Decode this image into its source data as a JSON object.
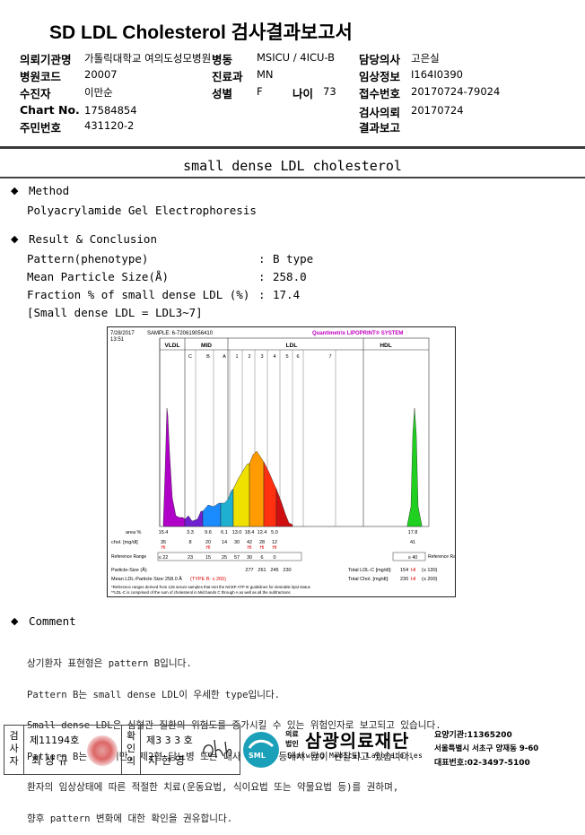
{
  "report_title": "SD LDL Cholesterol 검사결과보고서",
  "header": {
    "institution_label": "의뢰기관명",
    "institution_value": "가톨릭대학교 여의도성모병원",
    "ward_label": "병동",
    "ward_value": "MSICU / 4ICU-B",
    "doctor_label": "담당의사",
    "doctor_value": "고은실",
    "hospital_code_label": "병원코드",
    "hospital_code_value": "20007",
    "dept_label": "진료과",
    "dept_value": "MN",
    "clinical_info_label": "임상정보",
    "clinical_info_value": "I164I0390",
    "patient_label": "수진자",
    "patient_value": "이만순",
    "sex_label": "성별",
    "sex_value": "F",
    "age_label": "나이",
    "age_value": "73",
    "receipt_no_label": "접수번호",
    "receipt_no_value": "20170724-79024",
    "chart_no_label": "Chart No.",
    "chart_no_value": "17584854",
    "request_label": "검사의뢰",
    "request_value": "20170724",
    "resident_no_label": "주민번호",
    "resident_no_value": "431120-2",
    "result_report_label": "결과보고"
  },
  "section_title": "small dense LDL cholesterol",
  "method": {
    "heading": "Method",
    "text": "Polyacrylamide Gel Electrophoresis"
  },
  "result": {
    "heading": "Result & Conclusion",
    "rows": [
      {
        "label": "Pattern(phenotype)",
        "colon": ":",
        "value": "B type"
      },
      {
        "label": "Mean Particle Size(Å)",
        "colon": ":",
        "value": "258.0"
      },
      {
        "label": "Fraction % of small dense LDL (%)",
        "colon": ":",
        "value": "17.4"
      }
    ],
    "note": "[Small dense LDL = LDL3~7]"
  },
  "chart_data": {
    "type": "area",
    "date": "7/28/2017",
    "time": "13:51",
    "sample": "SAMPLE: 6-720619056410",
    "system": "Quantimetrix LIPOPRINT® SYSTEM",
    "regions": [
      "VLDL",
      "MID",
      "LDL",
      "HDL"
    ],
    "bands": [
      "C",
      "B",
      "A",
      "1",
      "2",
      "3",
      "4",
      "5",
      "6",
      "7"
    ],
    "colors": {
      "vldl": "#b000c8",
      "c": "#2e2ee0",
      "b": "#1a8cff",
      "a": "#1fb0d0",
      "l1": "#f0e000",
      "l2": "#ff9a00",
      "l3": "#ff3010",
      "l4": "#d01010",
      "hdl": "#20d020"
    },
    "table": {
      "area_label": "area %",
      "area": [
        "15.4",
        "3.3",
        "9.6",
        "6.1",
        "13.0",
        "18.4",
        "12.4",
        "5.0",
        "",
        "",
        "17.8"
      ],
      "chol_label": "chol. [mg/dl]",
      "chol": [
        "35",
        "8",
        "20",
        "14",
        "30",
        "42",
        "28",
        "12",
        "",
        "",
        "41"
      ],
      "chol_flags": [
        "HI",
        "",
        "HI",
        "",
        "",
        "HI",
        "HI",
        "HI",
        "",
        "",
        ""
      ],
      "ref_label": "Reference Range",
      "ref": [
        "≤ 22",
        "23",
        "15",
        "25",
        "57",
        "30",
        "6",
        "0",
        "",
        "",
        "≥ 40"
      ],
      "ref_label_right": "Reference Range",
      "particle_size_label": "Particle-Size (Å)",
      "particle_sizes": [
        "277",
        "261",
        "245",
        "230"
      ],
      "mean_size_label": "Mean LDL-Particle Size:",
      "mean_size_value": "258.0 Å",
      "type_label": "(TYPE B: ≤ 265)",
      "total_ldl_label": "Total LDL-C [mg/dl]:",
      "total_ldl_value": "154",
      "total_ldl_flag": "HI",
      "total_ldl_ref": "(≤ 130)",
      "total_chol_label": "Total Chol. [mg/dl]:",
      "total_chol_value": "230",
      "total_chol_flag": "HI",
      "total_chol_ref": "(≤ 200)"
    },
    "footnote1": "*Reference ranges derived from 125 serum samples that met the NCEP ATP III guidelines for desirable lipid status",
    "footnote2": "**LDL-C is comprised of the sum of cholesterol in Mid bands C through A as well as all the subfractions"
  },
  "comment": {
    "heading": "Comment",
    "lines": [
      "상기환자 표현형은 pattern B입니다.",
      "Pattern B는 small dense LDL이 우세한 type입니다.",
      "Small dense LDL은 심혈관 질환의 위험도를 증가시킬 수 있는 위험인자로 보고되고 있습니다.",
      "Pattern B는 복부비만, 제2형 당뇨병 또는 대사 증후군 등에서 많이 관찰되고 있습니다.",
      "환자의 임상상태에 따른 적절한 치료(운동요법, 식이요법 또는 약물요법 등)를 권하며,",
      "향후 pattern 변화에 대한 확인을 권유합니다."
    ]
  },
  "footer": {
    "examiner_label": "검사자",
    "examiner_no": "제11194호",
    "examiner_name": "최 상 규",
    "checker_label": "확인의",
    "checker_no": "제3 3 3 호",
    "checker_name": "지 현 영",
    "logo_small_top": "의료",
    "logo_small_bottom": "법인",
    "org_name": "삼광의료재단",
    "org_name_en": "Samkwang Medical Laboratories",
    "org_logo_text": "SML",
    "code_line": "요양기관:11365200",
    "address": "서울특별시 서초구 양재동 9-60",
    "phone": "대표번호:02-3497-5100"
  }
}
